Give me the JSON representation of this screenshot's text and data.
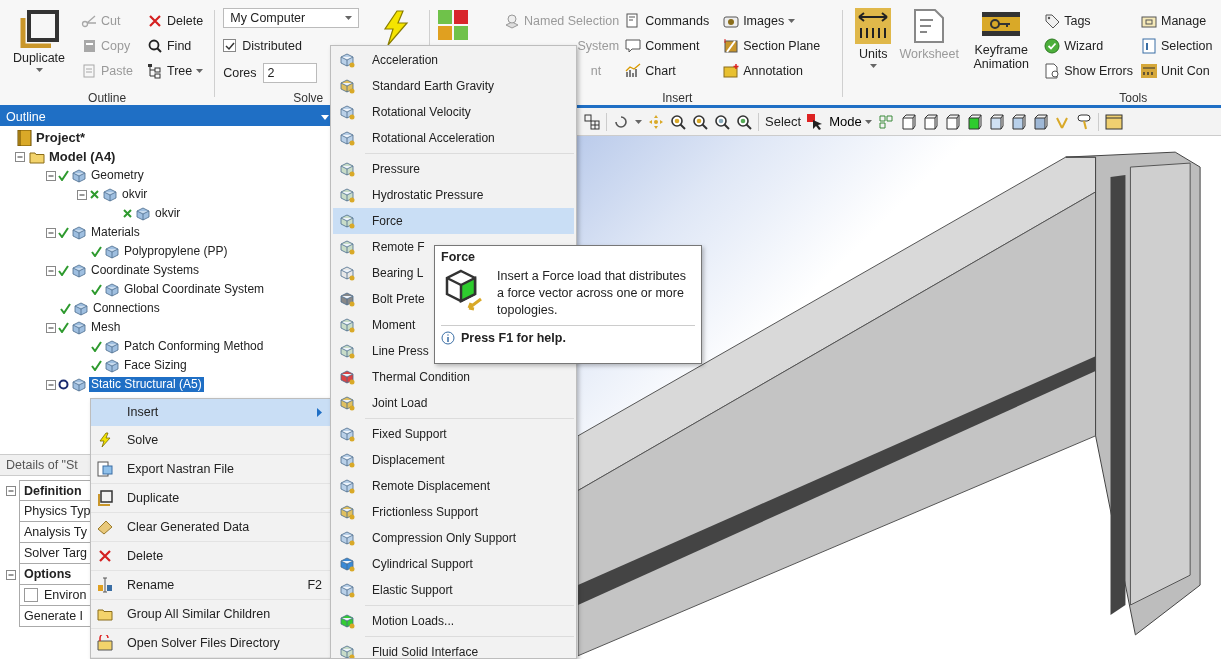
{
  "ribbon": {
    "outline_group": {
      "title": "Outline",
      "large_button": {
        "label": "Duplicate",
        "dropdown": true
      },
      "buttons": [
        {
          "label": "Cut",
          "disabled": true
        },
        {
          "label": "Copy",
          "disabled": true
        },
        {
          "label": "Paste",
          "disabled": true
        },
        {
          "label": "Delete",
          "disabled": false
        },
        {
          "label": "Find",
          "disabled": false
        },
        {
          "label": "Tree",
          "disabled": false,
          "dropdown": true
        }
      ]
    },
    "solve_group": {
      "title": "Solve",
      "computer": "My Computer",
      "distributed": {
        "label": "Distributed",
        "checked": true
      },
      "cores_label": "Cores",
      "cores": "2"
    },
    "environment_group": {
      "buttons": [
        {
          "label": "Named Selection",
          "disabled": true
        },
        {
          "label": "System",
          "disabled": true
        },
        {
          "label": "nt",
          "disabled": true
        }
      ]
    },
    "insert_group": {
      "title": "Insert",
      "buttons": [
        {
          "label": "Commands",
          "disabled": false
        },
        {
          "label": "Comment",
          "disabled": false
        },
        {
          "label": "Chart",
          "disabled": false
        },
        {
          "label": "Images",
          "disabled": false,
          "dropdown": true
        },
        {
          "label": "Section Plane",
          "disabled": false
        },
        {
          "label": "Annotation",
          "disabled": false
        }
      ]
    },
    "tools_group": {
      "title": "Tools",
      "large_buttons": [
        {
          "label": "Units",
          "disabled": false,
          "dropdown": true
        },
        {
          "label": "Worksheet",
          "disabled": true
        },
        {
          "label": "Keyframe Animation",
          "disabled": false
        }
      ],
      "buttons": [
        {
          "label": "Tags",
          "disabled": false
        },
        {
          "label": "Wizard",
          "disabled": false
        },
        {
          "label": "Show Errors",
          "disabled": false
        },
        {
          "label": "Manage",
          "disabled": false
        },
        {
          "label": "Selection",
          "disabled": false
        },
        {
          "label": "Unit Con",
          "disabled": false
        }
      ]
    }
  },
  "outline": {
    "title": "Outline",
    "tree": [
      {
        "label": "Project*",
        "kind": "root",
        "selected": false,
        "children": [
          {
            "label": "Model (A4)",
            "kind": "root",
            "selected": false,
            "expanded": true,
            "children": [
              {
                "label": "Geometry",
                "kind": "ok",
                "selected": false,
                "expanded": true,
                "children": [
                  {
                    "label": "okvir",
                    "kind": "suppressed",
                    "selected": false,
                    "expanded": true,
                    "children": [
                      {
                        "label": "okvir",
                        "kind": "suppressed",
                        "selected": false
                      }
                    ]
                  }
                ]
              },
              {
                "label": "Materials",
                "kind": "ok",
                "selected": false,
                "expanded": true,
                "children": [
                  {
                    "label": "Polypropylene (PP)",
                    "kind": "ok",
                    "selected": false
                  }
                ]
              },
              {
                "label": "Coordinate Systems",
                "kind": "ok",
                "selected": false,
                "expanded": true,
                "children": [
                  {
                    "label": "Global Coordinate System",
                    "kind": "ok",
                    "selected": false
                  }
                ]
              },
              {
                "label": "Connections",
                "kind": "ok",
                "selected": false
              },
              {
                "label": "Mesh",
                "kind": "ok",
                "selected": false,
                "expanded": true,
                "children": [
                  {
                    "label": "Patch Conforming Method",
                    "kind": "ok",
                    "selected": false
                  },
                  {
                    "label": "Face Sizing",
                    "kind": "ok",
                    "selected": false
                  }
                ]
              },
              {
                "label": "Static Structural (A5)",
                "kind": "undefined",
                "selected": true,
                "expanded": true
              }
            ]
          }
        ]
      }
    ]
  },
  "details": {
    "title": "Details of \"St",
    "sections": [
      {
        "label": "Definition",
        "expanded": true,
        "rows": [
          {
            "label": "Physics Typ",
            "kind": "text"
          },
          {
            "label": "Analysis Ty",
            "kind": "text"
          },
          {
            "label": "Solver Targ",
            "kind": "text"
          }
        ]
      },
      {
        "label": "Options",
        "expanded": true,
        "rows": [
          {
            "label": "Environ",
            "kind": "checkbox",
            "checked": false
          },
          {
            "label": "Generate I",
            "kind": "text"
          }
        ]
      }
    ]
  },
  "toolbar": {
    "select_label": "Select",
    "mode": "Mode"
  },
  "context_menu": {
    "items": [
      {
        "label": "Insert",
        "selected": true,
        "submenu": true
      },
      {
        "label": "Solve",
        "selected": false,
        "submenu": false
      },
      {
        "label": "Export Nastran File",
        "selected": false,
        "submenu": false
      },
      {
        "label": "Duplicate",
        "selected": false,
        "submenu": false
      },
      {
        "label": "Clear Generated Data",
        "selected": false,
        "submenu": false
      },
      {
        "label": "Delete",
        "selected": false,
        "submenu": false
      },
      {
        "label": "Rename",
        "selected": false,
        "submenu": false,
        "shortcut": "F2"
      },
      {
        "label": "Group All Similar Children",
        "selected": false,
        "submenu": false
      },
      {
        "label": "Open Solver Files Directory",
        "selected": false,
        "submenu": false
      }
    ]
  },
  "insert_submenu": {
    "groups": [
      [
        {
          "label": "Acceleration",
          "selected": false
        },
        {
          "label": "Standard Earth Gravity",
          "selected": false
        },
        {
          "label": "Rotational Velocity",
          "selected": false
        },
        {
          "label": "Rotational Acceleration",
          "selected": false
        }
      ],
      [
        {
          "label": "Pressure",
          "selected": false
        },
        {
          "label": "Hydrostatic Pressure",
          "selected": false
        },
        {
          "label": "Force",
          "selected": true
        },
        {
          "label": "Remote F",
          "selected": false
        },
        {
          "label": "Bearing L",
          "selected": false
        },
        {
          "label": "Bolt Prete",
          "selected": false
        },
        {
          "label": "Moment",
          "selected": false
        },
        {
          "label": "Line Press",
          "selected": false
        },
        {
          "label": "Thermal Condition",
          "selected": false
        },
        {
          "label": "Joint Load",
          "selected": false
        }
      ],
      [
        {
          "label": "Fixed Support",
          "selected": false
        },
        {
          "label": "Displacement",
          "selected": false
        },
        {
          "label": "Remote Displacement",
          "selected": false
        },
        {
          "label": "Frictionless Support",
          "selected": false
        },
        {
          "label": "Compression Only Support",
          "selected": false
        },
        {
          "label": "Cylindrical Support",
          "selected": false
        },
        {
          "label": "Elastic Support",
          "selected": false
        }
      ],
      [
        {
          "label": "Motion Loads...",
          "selected": false
        }
      ],
      [
        {
          "label": "Fluid Solid Interface",
          "selected": false
        }
      ]
    ]
  },
  "tooltip": {
    "title": "Force",
    "text": "Insert a Force load that distributes a force vector across one or more topologies.",
    "help": "Press F1 for help."
  }
}
